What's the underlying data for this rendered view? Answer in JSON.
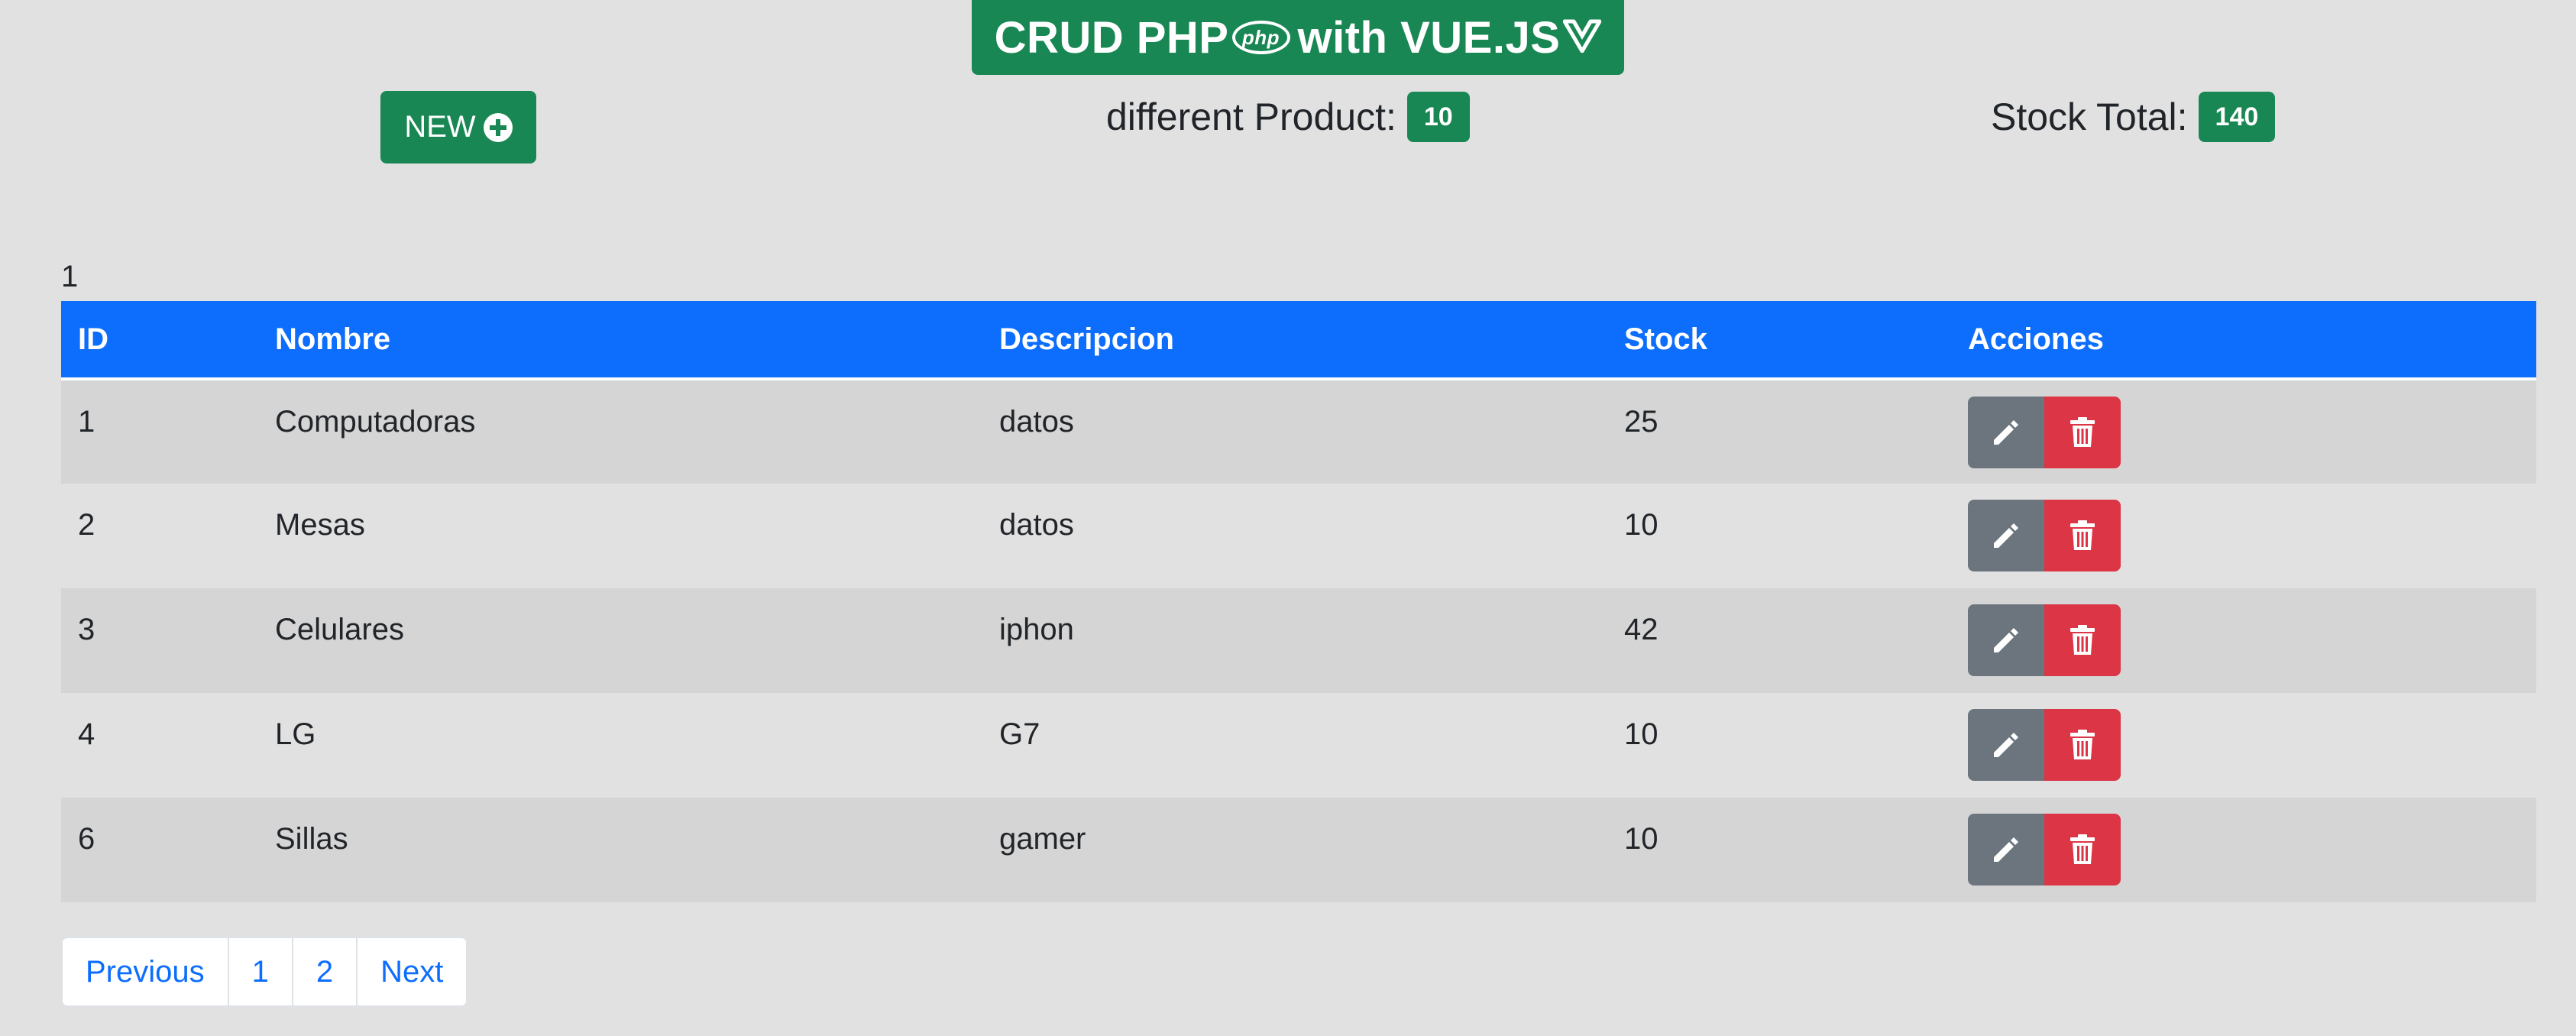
{
  "header": {
    "title_prefix": "CRUD PHP",
    "php_logo_text": "php",
    "title_suffix": "with VUE.JS"
  },
  "toolbar": {
    "new_label": "NEW"
  },
  "stats": {
    "products_label": "different Product:",
    "products_count": "10",
    "stock_label": "Stock Total:",
    "stock_total": "140"
  },
  "current_page_indicator": "1",
  "table": {
    "columns": [
      "ID",
      "Nombre",
      "Descripcion",
      "Stock",
      "Acciones"
    ],
    "rows": [
      {
        "id": "1",
        "nombre": "Computadoras",
        "descripcion": "datos",
        "stock": "25"
      },
      {
        "id": "2",
        "nombre": "Mesas",
        "descripcion": "datos",
        "stock": "10"
      },
      {
        "id": "3",
        "nombre": "Celulares",
        "descripcion": "iphon",
        "stock": "42"
      },
      {
        "id": "4",
        "nombre": "LG",
        "descripcion": "G7",
        "stock": "10"
      },
      {
        "id": "6",
        "nombre": "Sillas",
        "descripcion": "gamer",
        "stock": "10"
      }
    ]
  },
  "pagination": {
    "previous": "Previous",
    "pages": [
      "1",
      "2"
    ],
    "next": "Next"
  },
  "icons": {
    "new": "plus-circle-icon",
    "edit": "pencil-icon",
    "delete": "trash-icon"
  },
  "colors": {
    "success": "#198754",
    "primary": "#0d6efd",
    "secondary": "#6c757d",
    "danger": "#dc3545"
  }
}
